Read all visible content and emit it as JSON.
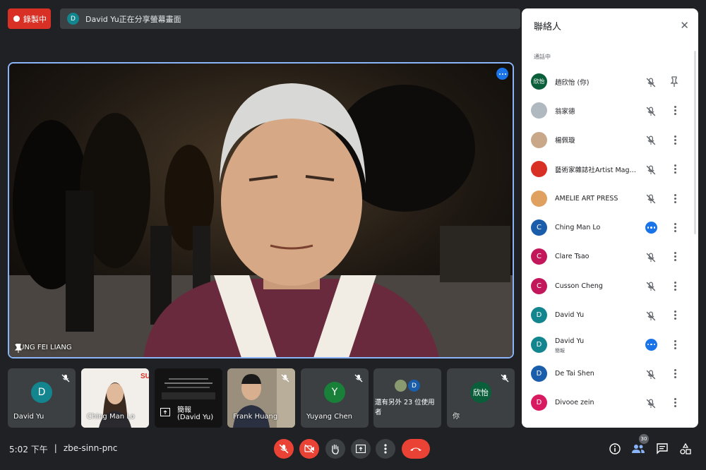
{
  "top_bar": {
    "recording_label": "錄製中",
    "share_avatar": "D",
    "share_text": "David Yu正在分享螢幕畫面"
  },
  "main_video": {
    "speaker_name": "YUNG FEI LIANG",
    "more_icon": "more-horiz-icon"
  },
  "strip": [
    {
      "name": "David Yu",
      "avatar": "D",
      "avatar_color": "#12858e",
      "muted": true,
      "kind": "avatar"
    },
    {
      "name": "Ching Man Lo",
      "kind": "video"
    },
    {
      "name": "簡報",
      "sub": "(David Yu)",
      "kind": "presentation"
    },
    {
      "name": "Frank Huang",
      "muted": true,
      "kind": "video"
    },
    {
      "name": "Yuyang Chen",
      "avatar": "Y",
      "avatar_color": "#188038",
      "muted": true,
      "kind": "avatar"
    },
    {
      "name": "還有另外 23 位使用者",
      "avatar": "D",
      "kind": "others"
    },
    {
      "name": "你",
      "avatar": "欣怡",
      "avatar_color": "#0b5e3a",
      "muted": true,
      "kind": "avatar"
    }
  ],
  "panel": {
    "title": "聯絡人",
    "section_label": "通話中",
    "people": [
      {
        "name": "趙欣怡 (你)",
        "avatar": "欣怡",
        "color": "#0b5e3a",
        "action": "pin"
      },
      {
        "name": "翁家德",
        "avatar": "",
        "color": "#b0b8c0",
        "action": "mic"
      },
      {
        "name": "楊佩璇",
        "avatar": "",
        "color": "#c9a88a",
        "action": "mic"
      },
      {
        "name": "藝術家雜誌社Artist Magazine",
        "avatar": "",
        "color": "#d93025",
        "action": "mic"
      },
      {
        "name": "AMELIE ART PRESS",
        "avatar": "",
        "color": "#e0a060",
        "action": "mic"
      },
      {
        "name": "Ching Man Lo",
        "avatar": "C",
        "color": "#1a5dab",
        "action": "speaking"
      },
      {
        "name": "Clare Tsao",
        "avatar": "C",
        "color": "#c2185b",
        "action": "mic"
      },
      {
        "name": "Cusson Cheng",
        "avatar": "C",
        "color": "#c2185b",
        "action": "mic"
      },
      {
        "name": "David Yu",
        "avatar": "D",
        "color": "#12858e",
        "action": "mic"
      },
      {
        "name": "David Yu",
        "sub": "簡報",
        "avatar": "D",
        "color": "#12858e",
        "action": "speaking"
      },
      {
        "name": "De Tai Shen",
        "avatar": "D",
        "color": "#1a5dab",
        "action": "mic"
      },
      {
        "name": "Divooe zein",
        "avatar": "D",
        "color": "#d81b60",
        "action": "mic"
      }
    ]
  },
  "bottom_bar": {
    "time": "5:02 下午",
    "separator": "|",
    "meeting_code": "zbe-sinn-pnc",
    "participants_count": "30"
  },
  "colors": {
    "background": "#202124",
    "danger": "#ea4335",
    "accent": "#1a73e8",
    "highlight_border": "#8ab4f8"
  }
}
